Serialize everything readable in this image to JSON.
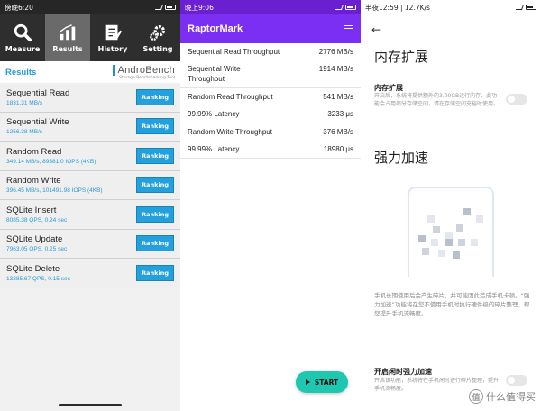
{
  "androbench": {
    "status": {
      "time": "傍晚6:20",
      "battery": ""
    },
    "nav": [
      {
        "label": "Measure",
        "icon": "search-icon",
        "active": false
      },
      {
        "label": "Results",
        "icon": "chart-icon",
        "active": true
      },
      {
        "label": "History",
        "icon": "history-icon",
        "active": false
      },
      {
        "label": "Setting",
        "icon": "gear-icon",
        "active": false
      }
    ],
    "results_title": "Results",
    "logo_name": "AndroBench",
    "logo_tagline": "Storage Benchmarking Tool",
    "ranking_label": "Ranking",
    "rows": [
      {
        "title": "Sequential Read",
        "value": "1831.31 MB/s"
      },
      {
        "title": "Sequential Write",
        "value": "1256.38 MB/s"
      },
      {
        "title": "Random Read",
        "value": "349.14 MB/s, 89381.0 IOPS (4KB)"
      },
      {
        "title": "Random Write",
        "value": "396.45 MB/s, 101491.98 IOPS (4KB)"
      },
      {
        "title": "SQLite Insert",
        "value": "8085.38 QPS, 0.24 sec"
      },
      {
        "title": "SQLite Update",
        "value": "7963.05 QPS, 0.25 sec"
      },
      {
        "title": "SQLite Delete",
        "value": "13285.67 QPS, 0.15 sec"
      }
    ]
  },
  "raptormark": {
    "status": {
      "time": "晚上9:06"
    },
    "title": "RaptorMark",
    "rows": [
      {
        "label": "Sequential Read Throughput",
        "value": "2776 MB/s",
        "line": false
      },
      {
        "label": "Sequential Write Throughput",
        "value": "1914 MB/s",
        "line": true
      },
      {
        "label": "Random Read Throughput",
        "value": "541 MB/s",
        "line": false
      },
      {
        "label": "99.99% Latency",
        "value": "3233 μs",
        "line": true
      },
      {
        "label": "Random Write Throughput",
        "value": "376 MB/s",
        "line": false
      },
      {
        "label": "99.99% Latency",
        "value": "18980 μs",
        "line": true
      }
    ],
    "start_label": "START"
  },
  "miui": {
    "status": {
      "time": "半夜12:59 | 12.7K/s"
    },
    "page_title": "内存扩展",
    "memory_ext_title": "内存扩展",
    "memory_ext_desc": "开启后，系统将提供额外的3.00GB运行内存，此功能会占用部分存储空间，请在存储空间充裕时使用。",
    "boost_title": "强力加速",
    "boost_desc": "手机长期使用后会产生碎片，并可能因此造成手机卡顿。“强力加速”功能将在您不使用手机时执行硬件级的碎片整理，帮您提升手机流畅度。",
    "idle_boost_title": "开启闲时强力加速",
    "idle_boost_desc": "开启该功能，系统将在手机闲时进行碎片整理，提升手机流畅度。",
    "watermark": "什么值得买",
    "watermark_badge": "值"
  }
}
